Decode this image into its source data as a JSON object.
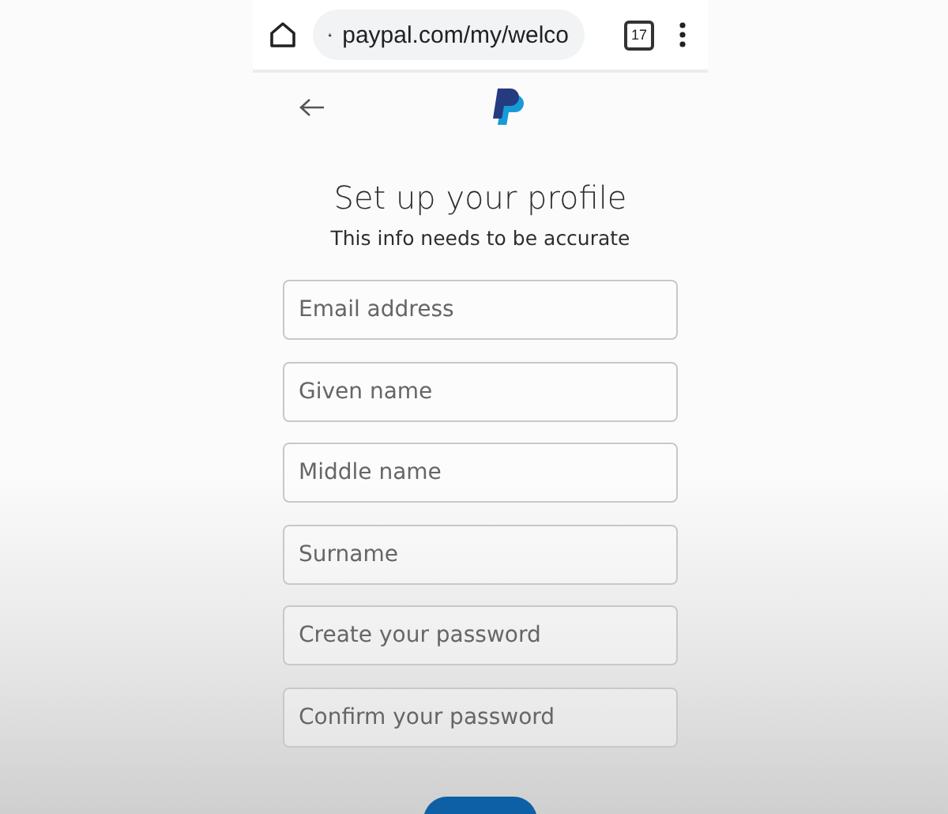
{
  "browser_bar": {
    "url": "paypal.com/my/welco",
    "tab_count": "17"
  },
  "page": {
    "title": "Set up your profile",
    "subtitle": "This info needs to be accurate"
  },
  "fields": [
    {
      "placeholder": "Email address"
    },
    {
      "placeholder": "Given name"
    },
    {
      "placeholder": "Middle name"
    },
    {
      "placeholder": "Surname"
    },
    {
      "placeholder": "Create your password"
    },
    {
      "placeholder": "Confirm your password"
    }
  ]
}
